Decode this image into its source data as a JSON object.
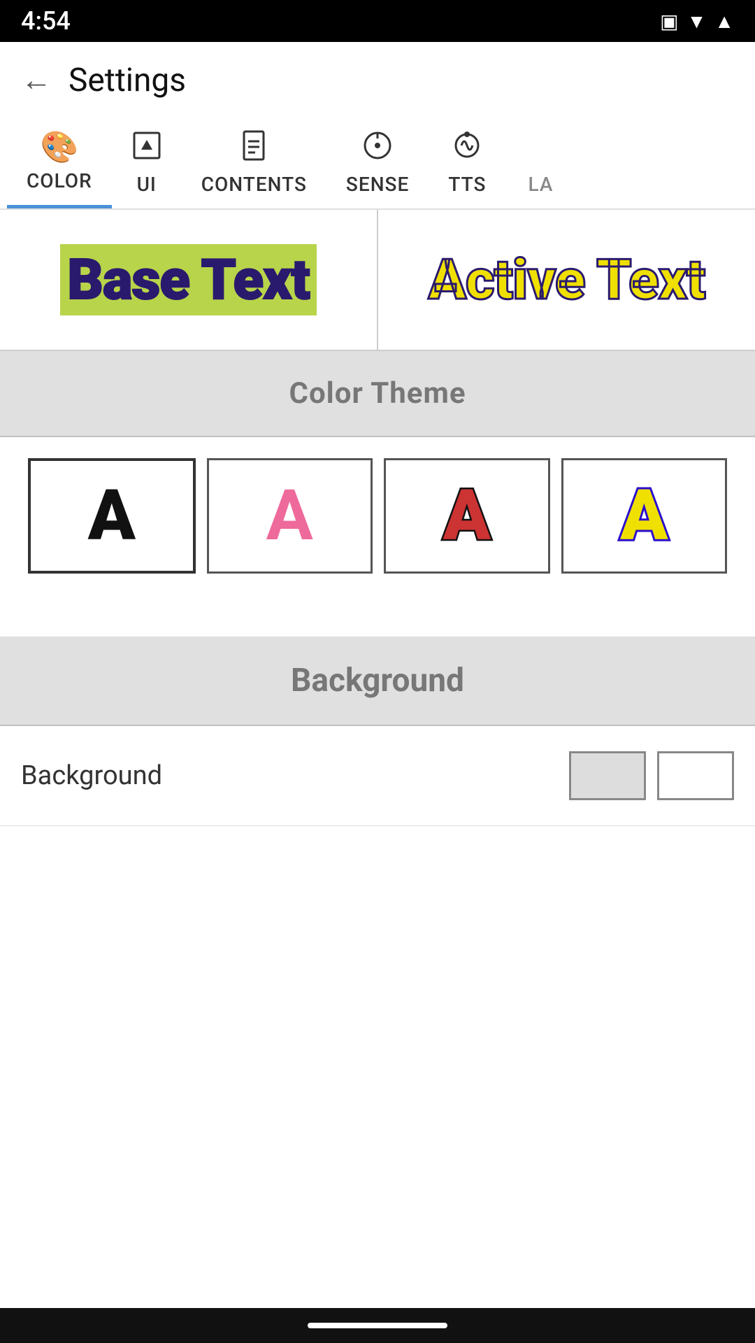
{
  "status_bar": {
    "time": "4:54",
    "icons": [
      "sim-card-icon",
      "wifi-icon",
      "signal-icon"
    ]
  },
  "top_bar": {
    "back_label": "←",
    "title": "Settings"
  },
  "tabs": [
    {
      "id": "color",
      "label": "COLOR",
      "icon": "🎨",
      "active": true
    },
    {
      "id": "ui",
      "label": "UI",
      "icon": "⬇️⬛",
      "active": false
    },
    {
      "id": "contents",
      "label": "CONTENTS",
      "icon": "📄",
      "active": false
    },
    {
      "id": "sense",
      "label": "SENSE",
      "icon": "⊙",
      "active": false
    },
    {
      "id": "tts",
      "label": "TTS",
      "icon": "📡",
      "active": false
    },
    {
      "id": "la",
      "label": "LA",
      "icon": "",
      "active": false
    }
  ],
  "preview": {
    "base_text": "Base Text",
    "active_text": "Active Text"
  },
  "color_theme": {
    "section_title": "Color Theme",
    "options": [
      {
        "id": "plain",
        "letter": "A",
        "style": "plain"
      },
      {
        "id": "pink",
        "letter": "A",
        "style": "pink"
      },
      {
        "id": "red-black",
        "letter": "A",
        "style": "red-black"
      },
      {
        "id": "yellow-blue",
        "letter": "A",
        "style": "yellow-blue"
      }
    ]
  },
  "background": {
    "section_title": "Background",
    "row_label": "Background",
    "swatches": [
      "gray",
      "white"
    ]
  }
}
